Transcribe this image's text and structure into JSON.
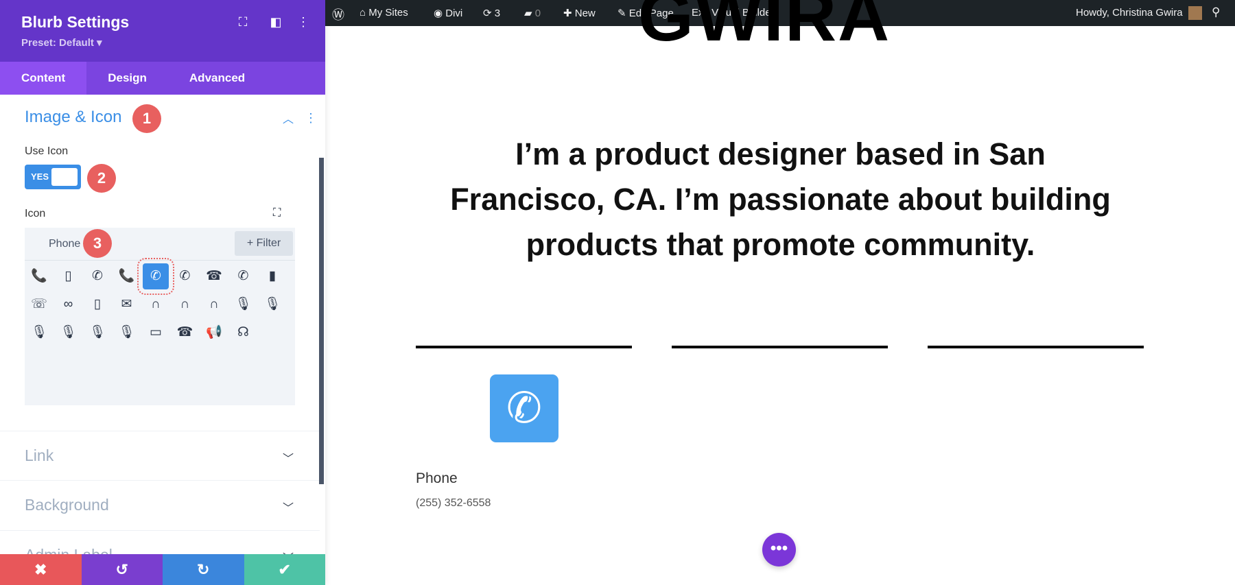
{
  "panel": {
    "title": "Blurb Settings",
    "preset": "Preset: Default ▾",
    "tabs": [
      "Content",
      "Design",
      "Advanced"
    ],
    "section": "Image & Icon",
    "use_icon_label": "Use Icon",
    "toggle": "YES",
    "icon_label": "Icon",
    "picker": {
      "category": "Phone",
      "filter": "+ Filter",
      "selected_index": 4,
      "icons": [
        "📞",
        "▯",
        "✆",
        "📞",
        "✆",
        "✆",
        "☎",
        "✆",
        "▮",
        "☏",
        "∞",
        "▯",
        "✉",
        "∩",
        "∩",
        "∩",
        "🎙",
        "🎙",
        "🎙",
        "🎙",
        "🎙",
        "🎙",
        "▭",
        "☎",
        "📢",
        "☊"
      ]
    },
    "sections": [
      "Link",
      "Background",
      "Admin Label"
    ],
    "badges": [
      "1",
      "2",
      "3"
    ],
    "colors": {
      "header": "#6435c9",
      "accent": "#3a8ee6",
      "cancel": "#e8575a",
      "undo": "#7a3ecf",
      "redo": "#3b86dc",
      "save": "#4ec3a6"
    }
  },
  "wpbar": {
    "my_sites": "My Sites",
    "divi": "Divi",
    "updates": "3",
    "comments": "0",
    "new": "New",
    "edit": "Edit Page",
    "exit": "Exit Visual Builder",
    "howdy": "Howdy, Christina Gwira"
  },
  "page": {
    "heading": "GWIRA",
    "bio": "I’m a product designer based in San Francisco, CA. I’m passionate about building products that promote community.",
    "blurb_title": "Phone",
    "blurb_text": "(255) 352-6558"
  }
}
